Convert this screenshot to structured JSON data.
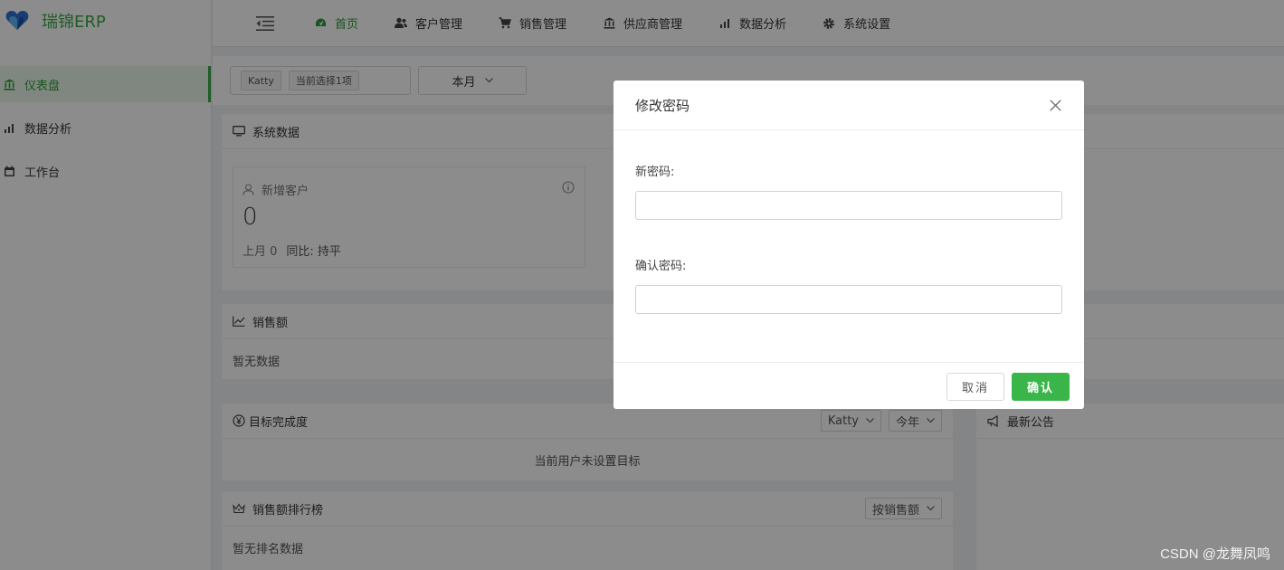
{
  "app": {
    "name": "瑞锦ERP",
    "accent": "#3aaa45"
  },
  "sidebar": {
    "items": [
      {
        "label": "仪表盘",
        "icon": "bank-icon",
        "active": true
      },
      {
        "label": "数据分析",
        "icon": "bar-chart-icon"
      },
      {
        "label": "工作台",
        "icon": "calendar-icon"
      }
    ]
  },
  "topnav": {
    "items": [
      {
        "label": "首页",
        "icon": "dashboard-icon",
        "active": true
      },
      {
        "label": "客户管理",
        "icon": "users-icon"
      },
      {
        "label": "销售管理",
        "icon": "cart-icon"
      },
      {
        "label": "供应商管理",
        "icon": "bank-icon"
      },
      {
        "label": "数据分析",
        "icon": "bar-chart-icon"
      },
      {
        "label": "系统设置",
        "icon": "gear-icon"
      }
    ]
  },
  "filter": {
    "user_tag": "Katty",
    "selection_tag": "当前选择1项",
    "period": "本月"
  },
  "system_panel": {
    "title": "系统数据",
    "card": {
      "title": "新增客户",
      "value": "0",
      "last_month_label": "上月 0",
      "compare_label": "同比: 持平"
    }
  },
  "sales_panel": {
    "title": "销售额",
    "empty": "暂无数据"
  },
  "goal_panel": {
    "title": "目标完成度",
    "user_select": "Katty",
    "period_select": "今年",
    "empty": "当前用户未设置目标"
  },
  "rank_panel": {
    "title": "销售额排行榜",
    "sort_select": "按销售额",
    "empty": "暂无排名数据"
  },
  "notice_panel": {
    "title": "最新公告"
  },
  "modal": {
    "title": "修改密码",
    "new_password_label": "新密码:",
    "new_password_value": "",
    "confirm_password_label": "确认密码:",
    "confirm_password_value": "",
    "cancel_label": "取消",
    "confirm_label": "确认"
  },
  "watermark": "CSDN @龙舞凤鸣"
}
